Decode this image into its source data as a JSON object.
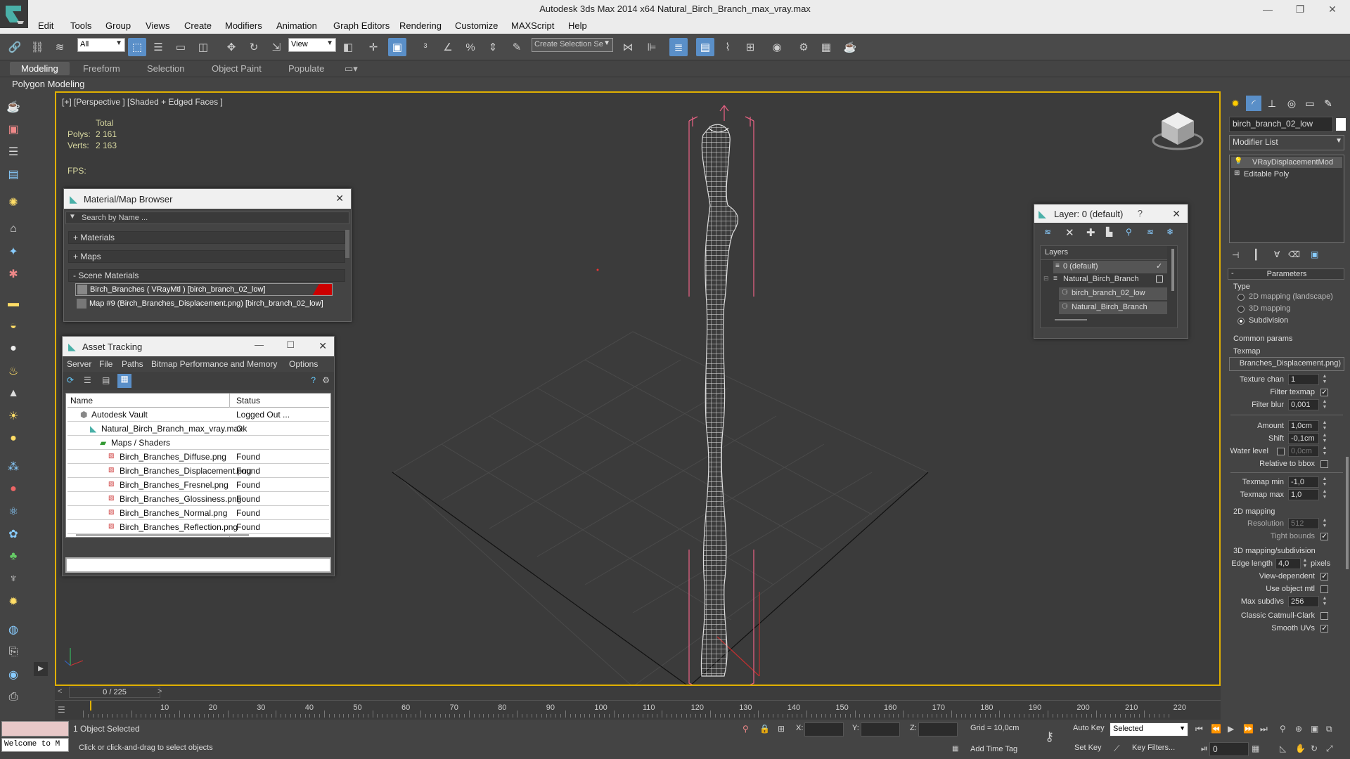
{
  "window": {
    "title": "Autodesk 3ds Max  2014 x64     Natural_Birch_Branch_max_vray.max"
  },
  "menu": [
    "Edit",
    "Tools",
    "Group",
    "Views",
    "Create",
    "Modifiers",
    "Animation",
    "Graph Editors",
    "Rendering",
    "Customize",
    "MAXScript",
    "Help"
  ],
  "toolbar": {
    "selection_filter": "All",
    "ref_coord": "View",
    "named_selection": "Create Selection Se"
  },
  "ribbon": {
    "tabs": [
      "Modeling",
      "Freeform",
      "Selection",
      "Object Paint",
      "Populate"
    ],
    "active": "Modeling",
    "sub": "Polygon Modeling"
  },
  "viewport": {
    "label": "[+] [Perspective ] [Shaded + Edged Faces ]",
    "stats_header": "Total",
    "polys_label": "Polys:",
    "polys_value": "2 161",
    "verts_label": "Verts:",
    "verts_value": "2 163",
    "fps_label": "FPS:"
  },
  "material_browser": {
    "title": "Material/Map Browser",
    "search_placeholder": "Search by Name ...",
    "groups": [
      "+ Materials",
      "+ Maps",
      "- Scene Materials"
    ],
    "items": [
      "Birch_Branches  ( VRayMtl )  [birch_branch_02_low]",
      "Map #9 (Birch_Branches_Displacement.png)  [birch_branch_02_low]"
    ]
  },
  "asset_tracking": {
    "title": "Asset Tracking",
    "menu": [
      "Server",
      "File",
      "Paths",
      "Bitmap Performance and Memory",
      "Options"
    ],
    "columns": [
      "Name",
      "Status"
    ],
    "rows": [
      {
        "name": "Autodesk Vault",
        "status": "Logged Out ..."
      },
      {
        "name": "Natural_Birch_Branch_max_vray.max",
        "status": "Ok"
      },
      {
        "name": "Maps / Shaders",
        "status": ""
      },
      {
        "name": "Birch_Branches_Diffuse.png",
        "status": "Found"
      },
      {
        "name": "Birch_Branches_Displacement.png",
        "status": "Found"
      },
      {
        "name": "Birch_Branches_Fresnel.png",
        "status": "Found"
      },
      {
        "name": "Birch_Branches_Glossiness.png",
        "status": "Found"
      },
      {
        "name": "Birch_Branches_Normal.png",
        "status": "Found"
      },
      {
        "name": "Birch_Branches_Reflection.png",
        "status": "Found"
      }
    ]
  },
  "layer_dialog": {
    "title": "Layer: 0 (default)",
    "help": "?",
    "header": "Layers",
    "items": [
      "0 (default)",
      "Natural_Birch_Branch",
      "birch_branch_02_low",
      "Natural_Birch_Branch"
    ]
  },
  "command_panel": {
    "object_name": "birch_branch_02_low",
    "modifier_list": "Modifier List",
    "stack": [
      "VRayDisplacementMod",
      "Editable Poly"
    ],
    "rollout": "Parameters",
    "type_label": "Type",
    "type_options": [
      "2D mapping (landscape)",
      "3D mapping",
      "Subdivision"
    ],
    "type_selected": "Subdivision",
    "common_params": "Common params",
    "texmap_label": "Texmap",
    "texmap_value": "Branches_Displacement.png)",
    "texture_chan_label": "Texture chan",
    "texture_chan": "1",
    "filter_texmap_label": "Filter texmap",
    "filter_blur_label": "Filter blur",
    "filter_blur": "0,001",
    "amount_label": "Amount",
    "amount": "1,0cm",
    "shift_label": "Shift",
    "shift": "-0,1cm",
    "water_level_label": "Water level",
    "water_level": "0,0cm",
    "relative_bbox_label": "Relative to bbox",
    "texmap_min_label": "Texmap min",
    "texmap_min": "-1,0",
    "texmap_max_label": "Texmap max",
    "texmap_max": "1,0",
    "mapping2d": "2D mapping",
    "resolution_label": "Resolution",
    "resolution": "512",
    "tight_bounds_label": "Tight bounds",
    "mapping3d": "3D mapping/subdivision",
    "edge_length_label": "Edge length",
    "edge_length": "4,0",
    "pixels": "pixels",
    "view_dependent_label": "View-dependent",
    "use_object_mtl_label": "Use object mtl",
    "max_subdivs_label": "Max subdivs",
    "max_subdivs": "256",
    "classic_catmull_label": "Classic Catmull-Clark",
    "smooth_uvs_label": "Smooth UVs"
  },
  "timeline": {
    "frame": "0 / 225",
    "ticks": [
      "10",
      "20",
      "30",
      "40",
      "50",
      "60",
      "70",
      "80",
      "90",
      "100",
      "110",
      "120",
      "130",
      "140",
      "150",
      "160",
      "170",
      "180",
      "190",
      "200",
      "210",
      "220"
    ]
  },
  "status": {
    "maxscript": "Welcome to M",
    "selection": "1 Object Selected",
    "prompt": "Click or click-and-drag to select objects",
    "x_label": "X:",
    "y_label": "Y:",
    "z_label": "Z:",
    "grid": "Grid = 10,0cm",
    "add_time_tag": "Add Time Tag",
    "auto_key": "Auto Key",
    "selected": "Selected",
    "set_key": "Set Key",
    "key_filters": "Key Filters...",
    "frame_field": "0"
  },
  "colors": {
    "accent": "#5a8fc8",
    "viewport_border": "#e0b000",
    "wire": "#e8e8e8",
    "bbox": "#e06080"
  }
}
